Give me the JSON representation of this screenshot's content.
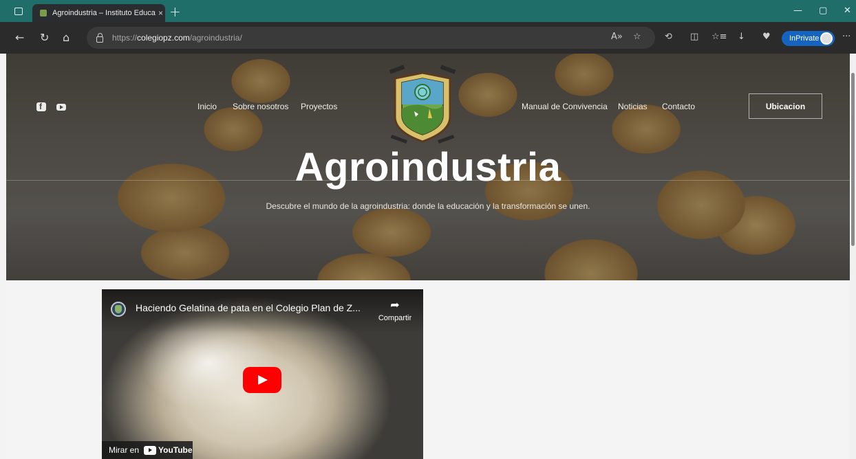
{
  "browser": {
    "tab_title": "Agroindustria – Instituto Educati",
    "tab_close": "×",
    "new_tab": "+",
    "window_controls": {
      "minimize": "—",
      "restore": "▢",
      "close": "✕"
    },
    "nav": {
      "back": "←",
      "refresh": "↻",
      "home": "⌂"
    },
    "url_prefix": "https://",
    "url_domain": "colegiopz.com",
    "url_path": "/agroindustria/",
    "toolbar": {
      "read_aloud": "A»",
      "favorite": "☆",
      "extensions": "⟲",
      "split": "◫",
      "favorites": "☆≡",
      "download": "↓",
      "health": "♥",
      "more": "···"
    },
    "inprivate_label": "InPrivate",
    "accent_color": "#1f6e6a"
  },
  "site": {
    "nav_links": [
      "Inicio",
      "Sobre nosotros",
      "Proyectos",
      "Manual de Convivencia",
      "Noticias",
      "Contacto"
    ],
    "cta_button": "Ubicacion",
    "social_icons": [
      "facebook-icon",
      "youtube-icon"
    ],
    "hero_title": "Agroindustria",
    "hero_subtitle": "Descubre el mundo de la agroindustria: donde la educación y la transformación se unen."
  },
  "video": {
    "title": "Haciendo Gelatina de pata en el Colegio Plan de Z...",
    "share_label": "Compartir",
    "watch_on": "Mirar en",
    "youtube_word": "YouTube"
  }
}
